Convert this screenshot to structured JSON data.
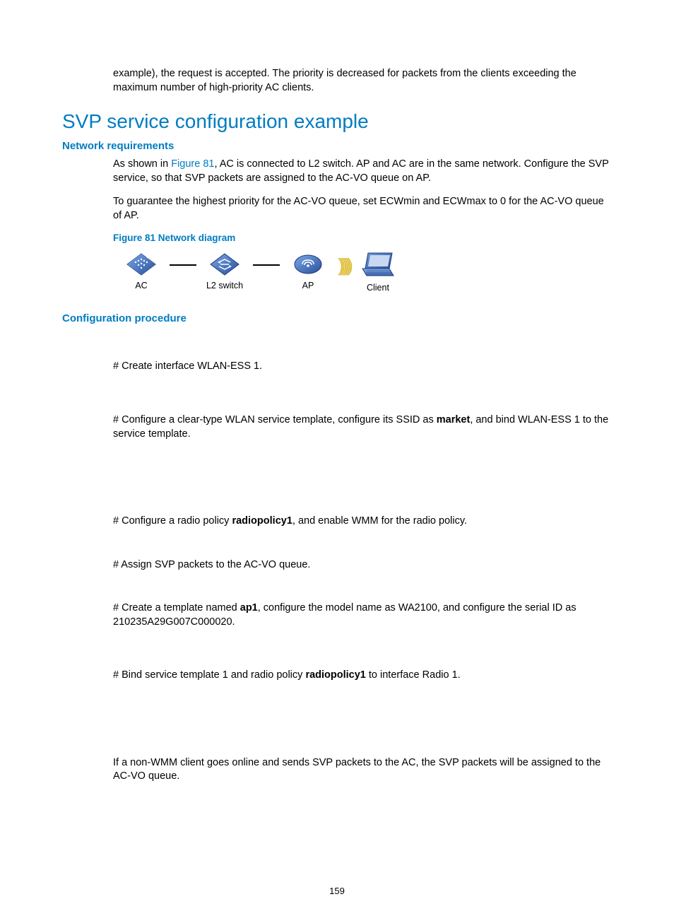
{
  "intro": "example), the request is accepted. The priority is decreased for packets from the clients exceeding the maximum number of high-priority AC clients.",
  "title": "SVP service configuration example",
  "net_req_heading": "Network requirements",
  "p1_pre": "As shown in ",
  "p1_link": "Figure 81",
  "p1_post": ", AC is connected to L2 switch. AP and AC are in the same network. Configure the SVP service, so that SVP packets are assigned to the AC-VO queue on AP.",
  "p2": "To guarantee the highest priority for the AC-VO queue, set ECWmin and ECWmax to 0 for the AC-VO queue of AP.",
  "fig_caption": "Figure 81 Network diagram",
  "diagram": {
    "ac": "AC",
    "l2": "L2 switch",
    "ap": "AP",
    "client": "Client"
  },
  "conf_heading": "Configuration procedure",
  "s1": "# Create interface WLAN-ESS 1.",
  "s2_pre": "# Configure a clear-type WLAN service template, configure its SSID as ",
  "s2_bold": "market",
  "s2_post": ", and bind WLAN-ESS 1 to the service template.",
  "s3_pre": "# Configure a radio policy ",
  "s3_bold": "radiopolicy1",
  "s3_post": ", and enable WMM for the radio policy.",
  "s4": "# Assign SVP packets to the AC-VO queue.",
  "s5_pre": "# Create a template named ",
  "s5_bold": "ap1",
  "s5_post": ", configure the model name as WA2100, and configure the serial ID as 210235A29G007C000020.",
  "s6_pre": "# Bind service template 1 and radio policy ",
  "s6_bold": "radiopolicy1",
  "s6_post": " to interface Radio 1.",
  "footnote": "If a non-WMM client goes online and sends SVP packets to the AC, the SVP packets will be assigned to the AC-VO queue.",
  "pagenum": "159"
}
